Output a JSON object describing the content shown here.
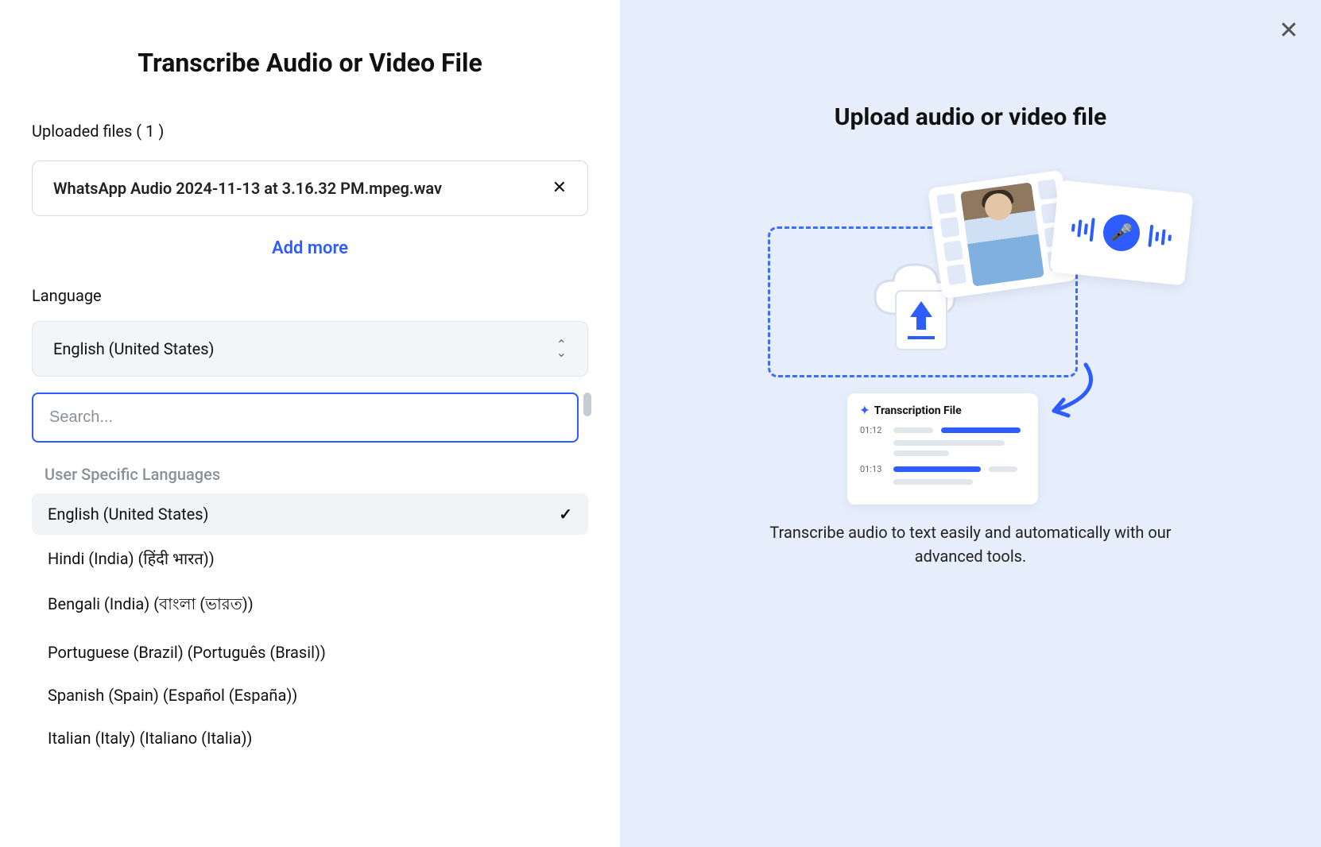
{
  "left": {
    "title": "Transcribe Audio or Video File",
    "uploadedLabel": "Uploaded files ( 1 )",
    "file": {
      "name": "WhatsApp Audio 2024-11-13 at 3.16.32 PM.mpeg.wav"
    },
    "addMore": "Add more",
    "languageLabel": "Language",
    "selectedLanguage": "English (United States)",
    "searchPlaceholder": "Search...",
    "sectionHeader": "User Specific Languages",
    "options": [
      {
        "label": "English (United States)",
        "selected": true
      },
      {
        "label": "Hindi (India) (हिंदी भारत))",
        "selected": false
      },
      {
        "label": "Bengali (India) (বাংলা (ভারত))",
        "selected": false
      },
      {
        "label": "Portuguese (Brazil) (Português (Brasil))",
        "selected": false
      },
      {
        "label": "Spanish (Spain) (Español (España))",
        "selected": false
      },
      {
        "label": "Italian (Italy) (Italiano (Italia))",
        "selected": false
      }
    ]
  },
  "right": {
    "title": "Upload audio or video file",
    "description": "Transcribe audio to text easily and automatically with our advanced tools.",
    "transcriptionCard": {
      "title": "Transcription File",
      "ts1": "01:12",
      "ts2": "01:13"
    }
  }
}
